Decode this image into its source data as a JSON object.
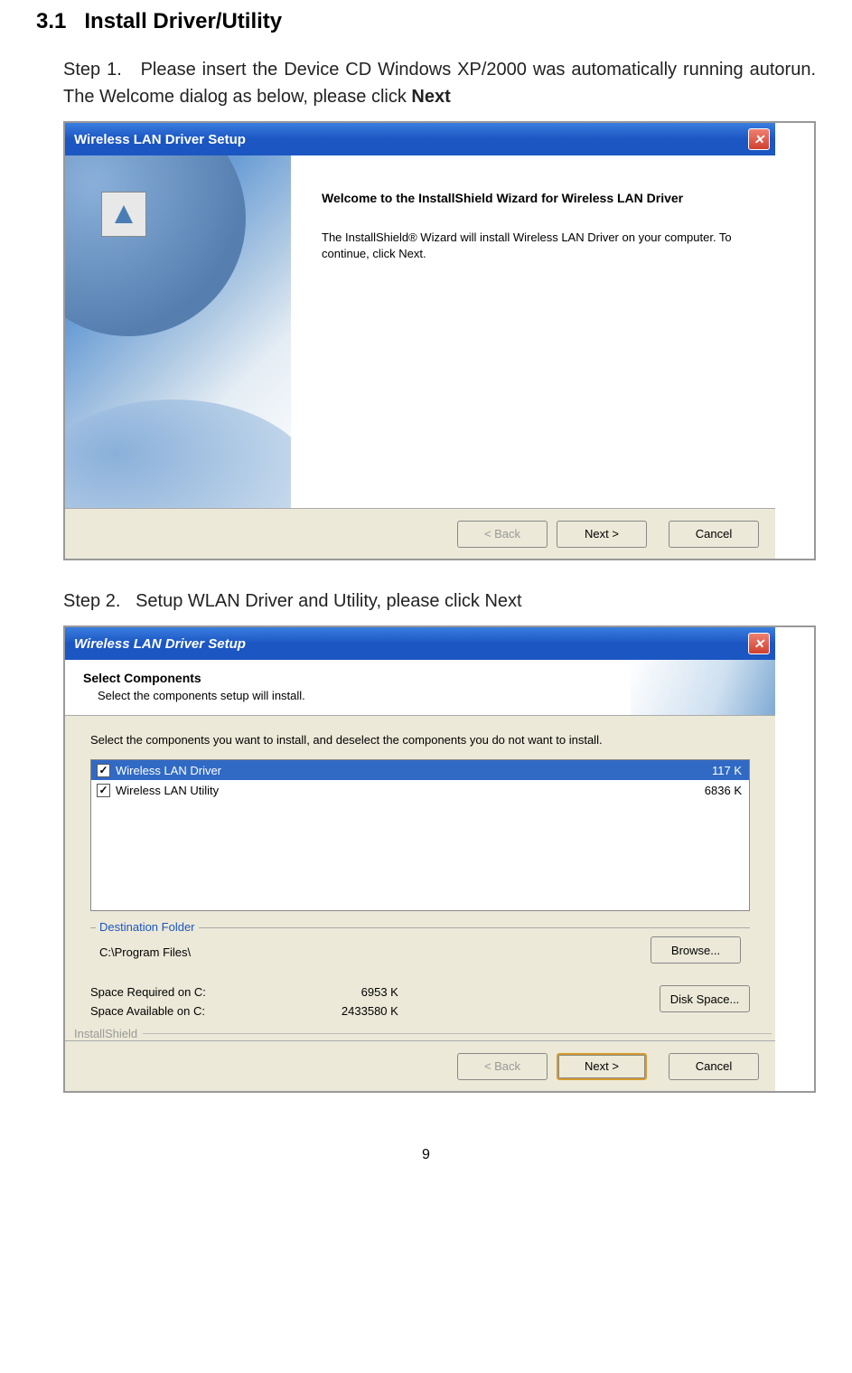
{
  "section": {
    "number": "3.1",
    "title": "Install Driver/Utility"
  },
  "step1": {
    "label": "Step 1.",
    "text_before_bold": "Please insert the Device CD Windows XP/2000 was automatically running autorun. The Welcome dialog as below, please click ",
    "bold": "Next"
  },
  "step2": {
    "label": "Step 2.",
    "text": "Setup WLAN Driver and Utility, please click Next"
  },
  "dialog1": {
    "title": "Wireless LAN Driver Setup",
    "welcome_title": "Welcome to the InstallShield Wizard for Wireless LAN Driver",
    "welcome_text": "The InstallShield® Wizard will install Wireless LAN Driver on your computer.  To continue, click Next.",
    "back": "< Back",
    "next": "Next >",
    "cancel": "Cancel"
  },
  "dialog2": {
    "title": "Wireless LAN Driver Setup",
    "header_title": "Select Components",
    "header_sub": "Select the components setup will install.",
    "instruction": "Select the components you want to install, and deselect the components you do not want to install.",
    "items": [
      {
        "label": "Wireless LAN Driver",
        "size": "117 K"
      },
      {
        "label": "Wireless LAN Utility",
        "size": "6836 K"
      }
    ],
    "dest_legend": "Destination Folder",
    "dest_path": "C:\\Program Files\\",
    "browse": "Browse...",
    "space_req_label": "Space Required on C:",
    "space_req_value": "6953 K",
    "space_avail_label": "Space Available on C:",
    "space_avail_value": "2433580 K",
    "disk_space": "Disk Space...",
    "install_shield": "InstallShield",
    "back": "< Back",
    "next": "Next >",
    "cancel": "Cancel"
  },
  "page_number": "9"
}
